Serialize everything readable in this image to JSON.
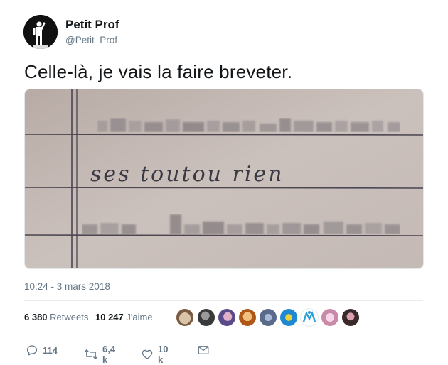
{
  "author": {
    "name": "Petit Prof",
    "handle": "@Petit_Prof"
  },
  "tweet": {
    "text": "Celle-là, je vais la faire breveter.",
    "handwriting": "ses toutou rien",
    "timestamp": "10:24 - 3 mars 2018"
  },
  "stats": {
    "retweets_count": "6 380",
    "retweets_label": "Retweets",
    "likes_count": "10 247",
    "likes_label": "J'aime"
  },
  "actions": {
    "replies": "114",
    "retweets": "6,4 k",
    "likes": "10 k"
  },
  "colors": {
    "text": "#14171a",
    "secondary": "#657786",
    "divider": "#e6ecf0",
    "paper": "#c7bcb6",
    "ink": "#3a3a44"
  },
  "icons": {
    "reply": "reply-icon",
    "retweet": "retweet-icon",
    "like": "heart-icon",
    "dm": "envelope-icon"
  }
}
